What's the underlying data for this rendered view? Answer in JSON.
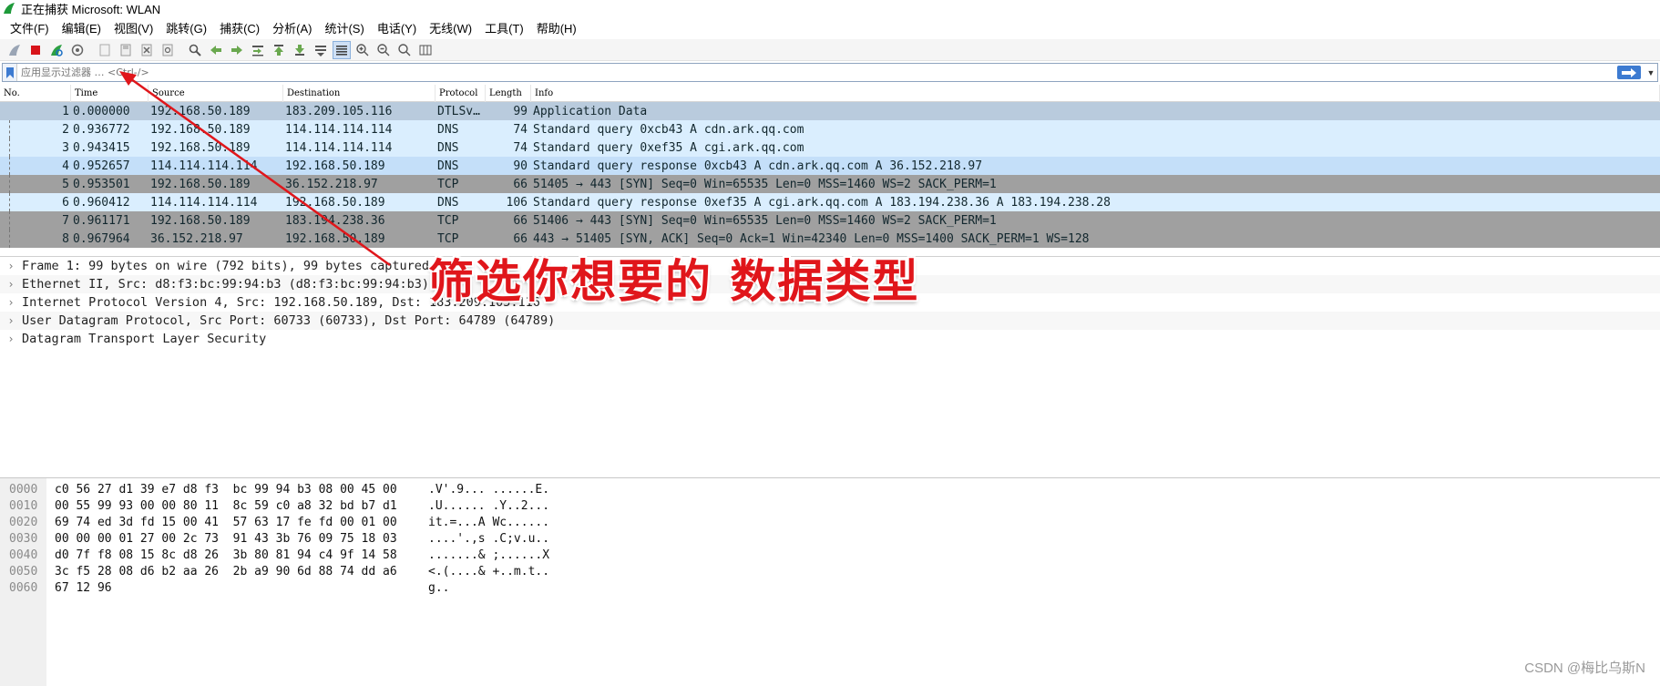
{
  "window": {
    "title": "正在捕获 Microsoft: WLAN"
  },
  "menu": [
    "文件(F)",
    "编辑(E)",
    "视图(V)",
    "跳转(G)",
    "捕获(C)",
    "分析(A)",
    "统计(S)",
    "电话(Y)",
    "无线(W)",
    "工具(T)",
    "帮助(H)"
  ],
  "toolbar_icons": [
    "shark-fin-start-icon",
    "stop-capture-icon",
    "restart-capture-icon",
    "capture-options-icon",
    "open-file-icon",
    "save-file-icon",
    "close-file-icon",
    "reload-file-icon",
    "find-packet-icon",
    "go-back-icon",
    "go-forward-icon",
    "go-to-packet-icon",
    "go-first-icon",
    "go-last-icon",
    "autoscroll-icon",
    "colorize-icon",
    "zoom-in-icon",
    "zoom-out-icon",
    "zoom-normal-icon",
    "resize-columns-icon"
  ],
  "filter": {
    "placeholder": "应用显示过滤器 … <Ctrl-/>"
  },
  "packet_list": {
    "columns": [
      "No.",
      "Time",
      "Source",
      "Destination",
      "Protocol",
      "Length",
      "Info"
    ],
    "rows": [
      {
        "no": "1",
        "time": "0.000000",
        "src": "192.168.50.189",
        "dst": "183.209.105.116",
        "proto": "DTLSv…",
        "len": "99",
        "info": "Application Data",
        "bg": "#b9cbdd"
      },
      {
        "no": "2",
        "time": "0.936772",
        "src": "192.168.50.189",
        "dst": "114.114.114.114",
        "proto": "DNS",
        "len": "74",
        "info": "Standard query 0xcb43 A cdn.ark.qq.com",
        "bg": "#daeefe"
      },
      {
        "no": "3",
        "time": "0.943415",
        "src": "192.168.50.189",
        "dst": "114.114.114.114",
        "proto": "DNS",
        "len": "74",
        "info": "Standard query 0xef35 A cgi.ark.qq.com",
        "bg": "#daeefe"
      },
      {
        "no": "4",
        "time": "0.952657",
        "src": "114.114.114.114",
        "dst": "192.168.50.189",
        "proto": "DNS",
        "len": "90",
        "info": "Standard query response 0xcb43 A cdn.ark.qq.com A 36.152.218.97",
        "bg": "#c4dff9"
      },
      {
        "no": "5",
        "time": "0.953501",
        "src": "192.168.50.189",
        "dst": "36.152.218.97",
        "proto": "TCP",
        "len": "66",
        "info": "51405 → 443 [SYN] Seq=0 Win=65535 Len=0 MSS=1460 WS=2 SACK_PERM=1",
        "bg": "#a0a0a0"
      },
      {
        "no": "6",
        "time": "0.960412",
        "src": "114.114.114.114",
        "dst": "192.168.50.189",
        "proto": "DNS",
        "len": "106",
        "info": "Standard query response 0xef35 A cgi.ark.qq.com A 183.194.238.36 A 183.194.238.28",
        "bg": "#daeefe"
      },
      {
        "no": "7",
        "time": "0.961171",
        "src": "192.168.50.189",
        "dst": "183.194.238.36",
        "proto": "TCP",
        "len": "66",
        "info": "51406 → 443 [SYN] Seq=0 Win=65535 Len=0 MSS=1460 WS=2 SACK_PERM=1",
        "bg": "#a0a0a0"
      },
      {
        "no": "8",
        "time": "0.967964",
        "src": "36.152.218.97",
        "dst": "192.168.50.189",
        "proto": "TCP",
        "len": "66",
        "info": "443 → 51405 [SYN, ACK] Seq=0 Ack=1 Win=42340 Len=0 MSS=1400 SACK_PERM=1 WS=128",
        "bg": "#a0a0a0"
      }
    ]
  },
  "details": [
    "Frame 1: 99 bytes on wire (792 bits), 99 bytes captured",
    "Ethernet II, Src: d8:f3:bc:99:94:b3 (d8:f3:bc:99:94:b3),",
    "Internet Protocol Version 4, Src: 192.168.50.189, Dst: 183.209.105.116",
    "User Datagram Protocol, Src Port: 60733 (60733), Dst Port: 64789 (64789)",
    "Datagram Transport Layer Security"
  ],
  "hex": [
    {
      "off": "0000",
      "bytes": "c0 56 27 d1 39 e7 d8 f3  bc 99 94 b3 08 00 45 00",
      "ascii": ".V'.9... ......E."
    },
    {
      "off": "0010",
      "bytes": "00 55 99 93 00 00 80 11  8c 59 c0 a8 32 bd b7 d1",
      "ascii": ".U...... .Y..2..."
    },
    {
      "off": "0020",
      "bytes": "69 74 ed 3d fd 15 00 41  57 63 17 fe fd 00 01 00",
      "ascii": "it.=...A Wc......"
    },
    {
      "off": "0030",
      "bytes": "00 00 00 01 27 00 2c 73  91 43 3b 76 09 75 18 03",
      "ascii": "....'.,s .C;v.u.."
    },
    {
      "off": "0040",
      "bytes": "d0 7f f8 08 15 8c d8 26  3b 80 81 94 c4 9f 14 58",
      "ascii": ".......& ;......X"
    },
    {
      "off": "0050",
      "bytes": "3c f5 28 08 d6 b2 aa 26  2b a9 90 6d 88 74 dd a6",
      "ascii": "<.(....& +..m.t.."
    },
    {
      "off": "0060",
      "bytes": "67 12 96",
      "ascii": "g.."
    }
  ],
  "annotation": {
    "text": "筛选你想要的 数据类型",
    "color": "#e0161b"
  },
  "watermark": "CSDN @梅比乌斯N",
  "colors": {
    "accent": "#3d7bd1",
    "arrow": "#e0161b"
  }
}
